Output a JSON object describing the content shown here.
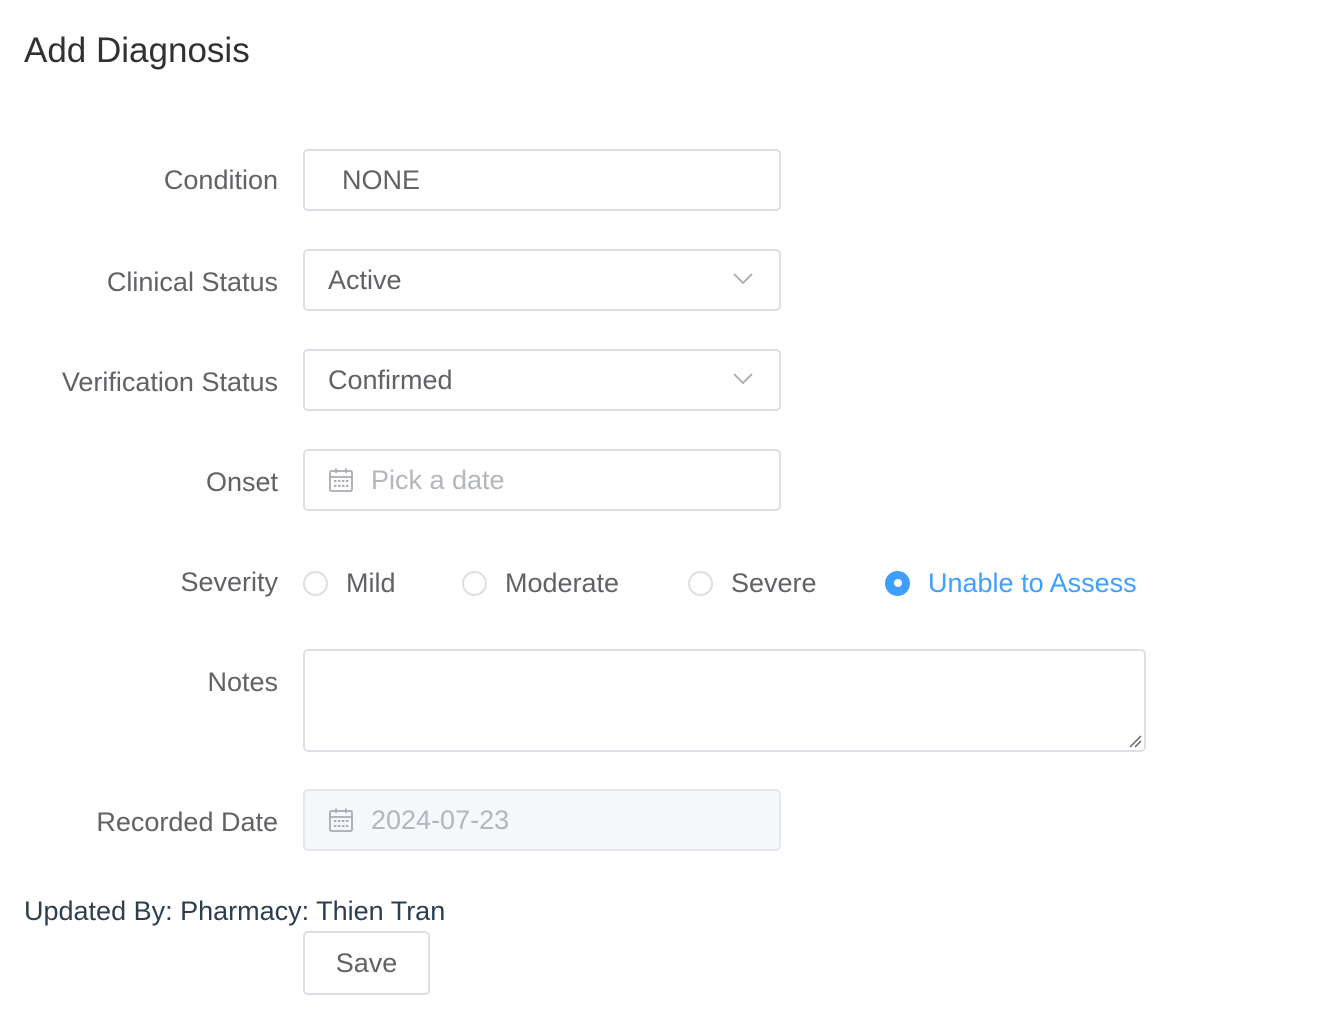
{
  "header": {
    "title": "Add Diagnosis"
  },
  "form": {
    "condition": {
      "label": "Condition",
      "value": "NONE"
    },
    "clinical_status": {
      "label": "Clinical Status",
      "value": "Active"
    },
    "verification_status": {
      "label": "Verification Status",
      "value": "Confirmed"
    },
    "onset": {
      "label": "Onset",
      "placeholder": "Pick a date"
    },
    "severity": {
      "label": "Severity",
      "options": [
        "Mild",
        "Moderate",
        "Severe",
        "Unable to Assess"
      ],
      "selected": "Unable to Assess"
    },
    "notes": {
      "label": "Notes",
      "value": ""
    },
    "recorded_date": {
      "label": "Recorded Date",
      "value": "2024-07-23"
    }
  },
  "footer": {
    "updated_by": "Updated By: Pharmacy: Thien Tran",
    "save_label": "Save"
  },
  "icons": {
    "dropdown": "chevron-down-icon",
    "date": "calendar-icon"
  },
  "colors": {
    "accent": "#409eff",
    "border": "#dcdfe6",
    "text": "#606266",
    "disabled_bg": "#f5f7fa"
  }
}
